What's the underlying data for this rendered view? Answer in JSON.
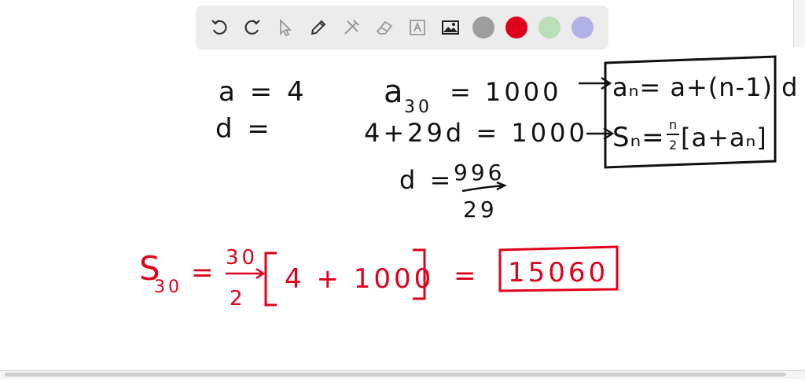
{
  "toolbar": {
    "colors": [
      "#9e9e9e",
      "#e0001b",
      "#b9dfb9",
      "#b1b1ea"
    ]
  },
  "board": {
    "a_line": "a = 4",
    "d_line": "d =",
    "a30_base": "a",
    "a30_sub": "30",
    "a30_rest": "= 1000",
    "eq_line": "4+29d = 1000",
    "d_eq": "d =",
    "d_num": "996",
    "d_den": "29",
    "formula1": "aₙ= a+(n-1) d",
    "formula2_lhs": "Sₙ=",
    "formula2_num": "n",
    "formula2_den": "2",
    "formula2_rhs": "[a+aₙ]",
    "s_base": "S",
    "s_sub": "30",
    "s_eq": "=",
    "frac_num": "30",
    "frac_den": "2",
    "bracket_content": "4 + 1000",
    "equals2": "=",
    "answer": "15060"
  }
}
